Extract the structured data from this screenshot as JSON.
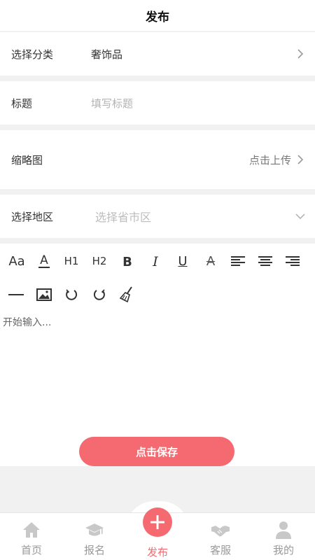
{
  "header": {
    "title": "发布"
  },
  "form": {
    "category": {
      "label": "选择分类",
      "value": "奢饰品"
    },
    "title": {
      "label": "标题",
      "placeholder": "填写标题"
    },
    "thumbnail": {
      "label": "缩略图",
      "action": "点击上传"
    },
    "region": {
      "label": "选择地区",
      "placeholder": "选择省市区"
    }
  },
  "editor": {
    "toolbar": {
      "font_size": "Aa",
      "font_color": "A",
      "h1": "H1",
      "h2": "H2",
      "bold": "B",
      "italic": "I",
      "underline": "U",
      "strike": "A"
    },
    "placeholder": "开始输入..."
  },
  "save_button": "点击保存",
  "tabbar": {
    "home": "首页",
    "signup": "报名",
    "publish": "发布",
    "service": "客服",
    "mine": "我的"
  },
  "colors": {
    "accent": "#f46a70",
    "inactive": "#999999"
  }
}
